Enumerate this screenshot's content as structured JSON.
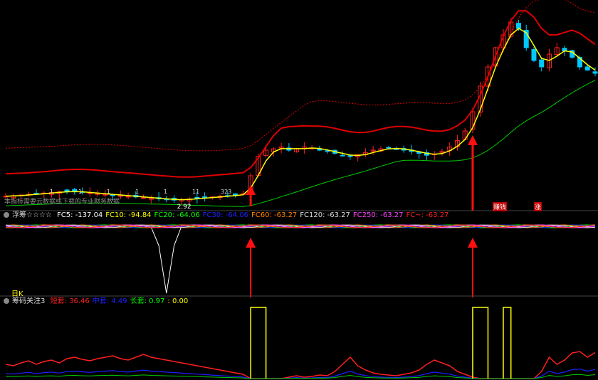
{
  "main_panel": {
    "notice": "本指标需要云数据或下载的专业财务数据",
    "price_label_low": "2.92",
    "tag_left": "赚钱",
    "tag_right": "涨",
    "cross_labels": [
      "1",
      "1",
      "1",
      "1",
      "1",
      "11",
      "323"
    ]
  },
  "panel1": {
    "title": "浮筹☆☆☆☆",
    "period_label": "日K",
    "fields": [
      {
        "label": "FC5:",
        "value": "-137.04",
        "color": "#ffffff"
      },
      {
        "label": "FC10:",
        "value": "-94.84",
        "color": "#ffff00"
      },
      {
        "label": "FC20:",
        "value": "-64.06",
        "color": "#00ff00"
      },
      {
        "label": "FC30:",
        "value": "-64.06",
        "color": "#2020ff"
      },
      {
        "label": "FC60:",
        "value": "-63.27",
        "color": "#ff8000"
      },
      {
        "label": "FC120:",
        "value": "-63.27",
        "color": "#dddddd"
      },
      {
        "label": "FC250:",
        "value": "-63.27",
        "color": "#ff40ff"
      },
      {
        "label": "FC~:",
        "value": "-63.27",
        "color": "#ff2020"
      }
    ]
  },
  "panel2": {
    "title": "筹码关注3",
    "fields": [
      {
        "label": "短套:",
        "value": "36.46",
        "color": "#ff2020"
      },
      {
        "label": "中套:",
        "value": "4.49",
        "color": "#2020ff"
      },
      {
        "label": "长套:",
        "value": "0.97",
        "color": "#00ff00"
      },
      {
        "label": ":",
        "value": "0.00",
        "color": "#ffff00"
      }
    ]
  },
  "colors": {
    "up": "#ff2020",
    "down": "#00c8ff",
    "ma_fast": "#ffff00",
    "ma_slow": "#00cc00",
    "band": "#dd0000",
    "arrow": "#ff1010"
  },
  "chart_data": [
    {
      "type": "candlestick",
      "title": "",
      "note": "Price chart with moving averages, red upper envelope, green long-term MA; two red upward arrows marking breakout points",
      "price_low_label": 2.92,
      "series": [
        {
          "name": "",
          "kind": "close_trend",
          "values": [
            2.98,
            2.99,
            3.0,
            3.01,
            3.02,
            3.03,
            3.04,
            3.05,
            3.06,
            3.05,
            3.04,
            3.03,
            3.02,
            3.01,
            3.0,
            2.99,
            2.98,
            2.97,
            2.96,
            2.95,
            2.94,
            2.93,
            2.92,
            2.93,
            2.94,
            2.95,
            2.96,
            2.97,
            2.98,
            2.99,
            3.0,
            3.02,
            3.3,
            3.6,
            3.7,
            3.72,
            3.75,
            3.7,
            3.72,
            3.75,
            3.73,
            3.7,
            3.68,
            3.65,
            3.62,
            3.6,
            3.63,
            3.66,
            3.7,
            3.72,
            3.74,
            3.72,
            3.7,
            3.68,
            3.65,
            3.62,
            3.64,
            3.68,
            3.75,
            3.85,
            4.0,
            4.3,
            4.7,
            5.0,
            5.3,
            5.5,
            5.7,
            5.6,
            5.3,
            5.1,
            5.0,
            5.2,
            5.3,
            5.25,
            5.15,
            5.0,
            4.95,
            4.9
          ]
        }
      ]
    },
    {
      "type": "line",
      "title": "",
      "series": [
        {
          "name": "FC5",
          "last": -137.04
        },
        {
          "name": "FC10",
          "last": -94.84
        },
        {
          "name": "FC20",
          "last": -64.06
        },
        {
          "name": "FC30",
          "last": -64.06
        },
        {
          "name": "FC60",
          "last": -63.27
        },
        {
          "name": "FC120",
          "last": -63.27
        },
        {
          "name": "FC250",
          "last": -63.27
        },
        {
          "name": "FC~",
          "last": -63.27
        }
      ]
    },
    {
      "type": "line",
      "title": "",
      "series": [
        {
          "name": "短套",
          "last": 36.46,
          "values": [
            20,
            18,
            22,
            25,
            20,
            24,
            26,
            22,
            28,
            30,
            27,
            25,
            28,
            30,
            32,
            28,
            26,
            30,
            34,
            30,
            28,
            26,
            24,
            22,
            20,
            18,
            16,
            14,
            12,
            10,
            8,
            6,
            0,
            0,
            0,
            0,
            0,
            2,
            4,
            2,
            3,
            5,
            4,
            10,
            20,
            30,
            18,
            12,
            8,
            6,
            5,
            4,
            6,
            8,
            12,
            20,
            26,
            22,
            18,
            10,
            6,
            2,
            0,
            0,
            0,
            0,
            0,
            0,
            0,
            0,
            10,
            30,
            20,
            26,
            36,
            38,
            30,
            36.46
          ]
        },
        {
          "name": "中套",
          "last": 4.49
        },
        {
          "name": "长套",
          "last": 0.97
        },
        {
          "name": "",
          "last": 0.0
        }
      ]
    }
  ]
}
